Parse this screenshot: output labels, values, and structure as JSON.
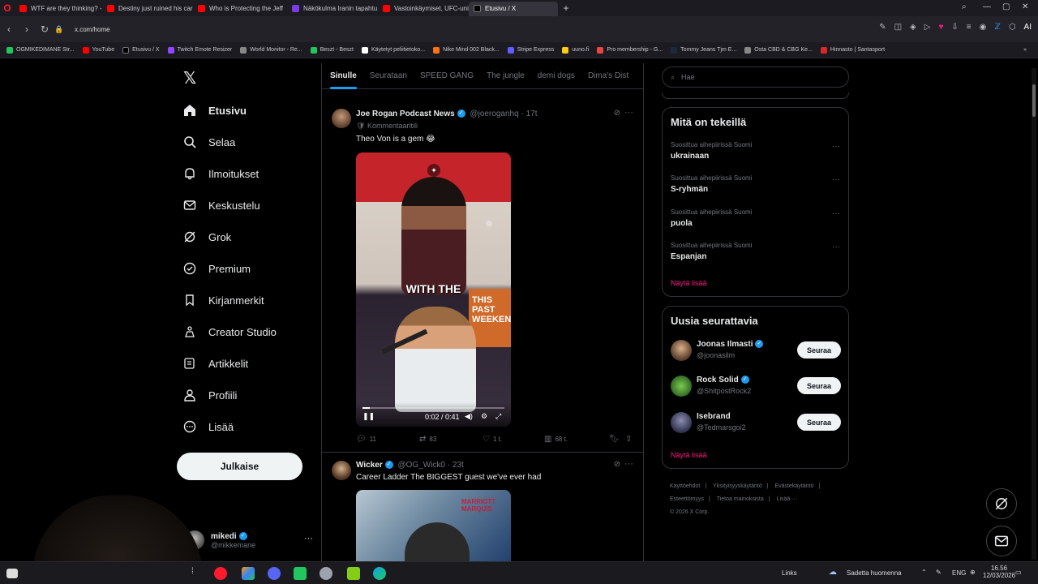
{
  "browser": {
    "tabs": [
      {
        "label": "WTF are they thinking? - Y"
      },
      {
        "label": "Destiny just ruined his car"
      },
      {
        "label": "Who is Protecting the Jeff"
      },
      {
        "label": "Näkökulma Iranin tapahtu"
      },
      {
        "label": "Vastoinkäymiset, UFC-uni"
      },
      {
        "label": "Etusivu / X"
      }
    ],
    "url": "x.com/home",
    "new_tab": "+",
    "bookmarks": [
      "OGMIKEDIMANE Str...",
      "YouTube",
      "Etusivu / X",
      "Twitch Emote Resizer",
      "World Monitor - Re...",
      "Beszt - Beszt",
      "Käytetyt peliitietoko...",
      "Nike Mind 002 Black...",
      "Stripe Express",
      "uuno.fi",
      "Pro membership - G...",
      "Tommy Jeans Tjm E...",
      "Osta CBD & CBG Ke...",
      "Hinnasto | Santasport"
    ],
    "ai_label": "AI"
  },
  "nav": {
    "items": [
      {
        "label": "Etusivu",
        "icon": "home-icon"
      },
      {
        "label": "Selaa",
        "icon": "search-icon"
      },
      {
        "label": "Ilmoitukset",
        "icon": "bell-icon"
      },
      {
        "label": "Keskustelu",
        "icon": "mail-icon"
      },
      {
        "label": "Grok",
        "icon": "grok-icon"
      },
      {
        "label": "Premium",
        "icon": "verified-icon"
      },
      {
        "label": "Kirjanmerkit",
        "icon": "bookmark-icon"
      },
      {
        "label": "Creator Studio",
        "icon": "creator-icon"
      },
      {
        "label": "Artikkelit",
        "icon": "article-icon"
      },
      {
        "label": "Profiili",
        "icon": "profile-icon"
      },
      {
        "label": "Lisää",
        "icon": "more-icon"
      }
    ],
    "post_button": "Julkaise",
    "account": {
      "name": "mikedi",
      "handle": "@mikkemane",
      "more": "···"
    }
  },
  "feed": {
    "tabs": [
      "Sinulle",
      "Seurataan",
      "SPEED GANG",
      "The jungle",
      "demi dogs",
      "Dima's Dist"
    ],
    "tweets": [
      {
        "name": "Joe Rogan Podcast News",
        "handle": "@joeroganhq",
        "time": "17t",
        "sub": "Kommentaaritili",
        "text": "Theo Von is a gem 😂",
        "video": {
          "caption": "WITH THE",
          "sign": "THIS PAST WEEKEND",
          "time": "0:02 / 0:41",
          "progress": 0.05
        },
        "stats": {
          "replies": "11",
          "reposts": "83",
          "likes": "1 t.",
          "views": "68 t."
        }
      },
      {
        "name": "Wicker",
        "handle": "@OG_Wick0",
        "time": "23t",
        "text": "Career Ladder The BIGGEST guest we've ever had",
        "media_sign": "MARRIOTT MARQUIS"
      }
    ]
  },
  "sidebar": {
    "search_placeholder": "Hae",
    "trends_title": "Mitä on tekeillä",
    "trends": [
      {
        "context": "Suosittua aihepiirissä Suomi",
        "name": "ukrainaan"
      },
      {
        "context": "Suosittua aihepiirissä Suomi",
        "name": "S-ryhmän"
      },
      {
        "context": "Suosittua aihepiirissä Suomi",
        "name": "puola"
      },
      {
        "context": "Suosittua aihepiirissä Suomi",
        "name": "Espanjan"
      }
    ],
    "show_more": "Näytä lisää",
    "follow_title": "Uusia seurattavia",
    "follows": [
      {
        "name": "Joonas Ilmasti",
        "handle": "@joonasilm",
        "button": "Seuraa"
      },
      {
        "name": "Rock Solid",
        "handle": "@ShitpostRock2",
        "button": "Seuraa"
      },
      {
        "name": "Isebrand",
        "handle": "@Tedmarsgoi2",
        "button": "Seuraa"
      }
    ],
    "follow_show_more": "Näytä lisää",
    "footer": [
      "Käyttöehdot",
      "Yksityisyyskäytäntö",
      "Evästekäytäntö",
      "Esteettömyys",
      "Tietoa mainoksista",
      "Lisää ···",
      "© 2026 X Corp."
    ]
  },
  "taskbar": {
    "links": "Links",
    "weather": "Sadetta huomenna",
    "lang": "ENG",
    "time": "16.56",
    "date": "12/03/2026"
  },
  "colors": {
    "accent": "#1d9bf0",
    "show_more": "#f91880",
    "bg": "#000000"
  }
}
